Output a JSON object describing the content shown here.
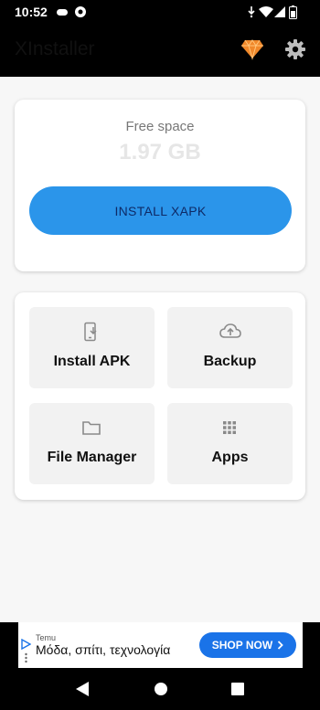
{
  "status_bar": {
    "time": "10:52",
    "icons": [
      "game-controller-icon",
      "circle-app-icon",
      "signal-icon",
      "wifi-icon",
      "cell-signal-icon",
      "battery-icon"
    ]
  },
  "app_bar": {
    "title": "XInstaller",
    "icons": [
      "gem-icon",
      "gear-icon"
    ]
  },
  "storage_card": {
    "free_space_label": "Free space",
    "free_space_value": "1.97 GB",
    "install_button_label": "INSTALL XAPK"
  },
  "actions": [
    {
      "label": "Install APK",
      "icon": "phone-download-icon"
    },
    {
      "label": "Backup",
      "icon": "cloud-upload-icon"
    },
    {
      "label": "File Manager",
      "icon": "folder-icon"
    },
    {
      "label": "Apps",
      "icon": "apps-grid-icon"
    }
  ],
  "ad": {
    "brand": "Temu",
    "text": "Μόδα, σπίτι, τεχνολογία",
    "button_label": "SHOP NOW"
  },
  "navigation": {
    "buttons": [
      "back-icon",
      "home-icon",
      "recents-icon"
    ]
  },
  "colors": {
    "accent": "#2b95ea",
    "button_text": "#0e2a66",
    "ad_button": "#1a73e8",
    "gem": "#f0882a"
  }
}
